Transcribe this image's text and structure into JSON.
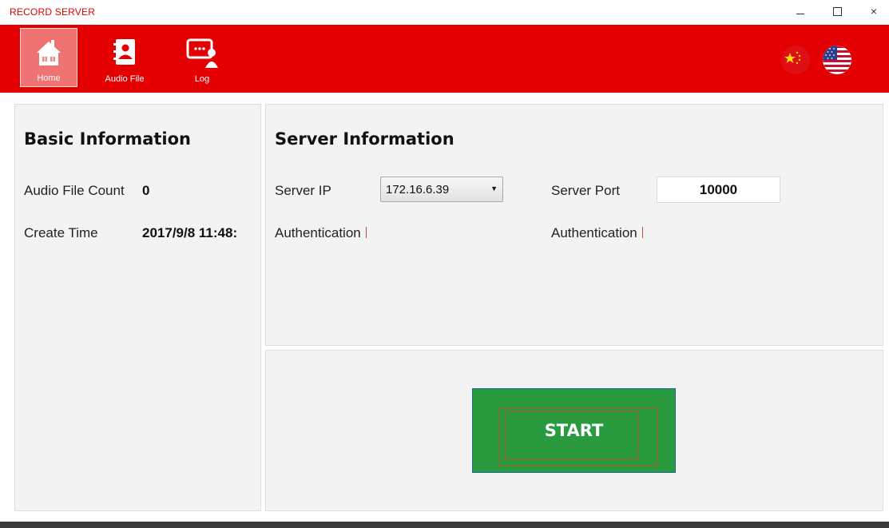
{
  "window": {
    "title": "RECORD SERVER",
    "minimize_label": "–",
    "maximize_label": "□",
    "close_label": "×"
  },
  "toolbar": {
    "items": [
      {
        "label": "Home",
        "icon": "home-icon",
        "active": true
      },
      {
        "label": "Audio File",
        "icon": "address-book-icon",
        "active": false
      },
      {
        "label": "Log",
        "icon": "presentation-user-icon",
        "active": false
      }
    ],
    "languages": [
      {
        "icon": "china-flag-icon"
      },
      {
        "icon": "usa-flag-icon"
      }
    ]
  },
  "basic_info": {
    "title": "Basic Information",
    "audio_file_count_label": "Audio File Count",
    "audio_file_count_value": "0",
    "create_time_label": "Create Time",
    "create_time_value": "2017/9/8 11:48:"
  },
  "server_info": {
    "title": "Server Information",
    "server_ip_label": "Server IP",
    "server_ip_value": "172.16.6.39",
    "server_port_label": "Server Port",
    "server_port_value": "10000",
    "authentication_label_1": "Authentication",
    "authentication_label_2": "Authentication"
  },
  "actions": {
    "start_label": "START"
  },
  "colors": {
    "brand_red": "#e40000",
    "start_green": "#2a9a3f",
    "panel_bg": "#f3f3f3"
  }
}
